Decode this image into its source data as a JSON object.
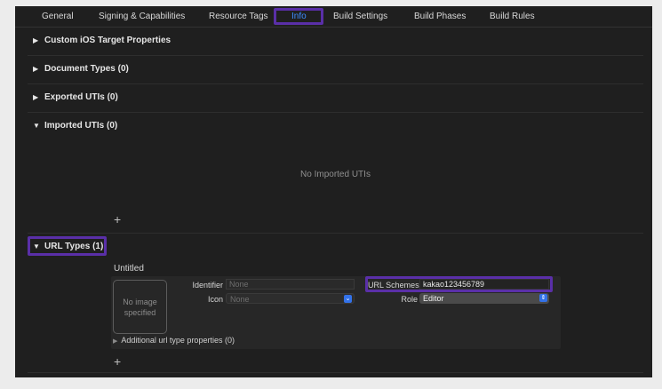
{
  "tabs": [
    {
      "label": "General",
      "selected": false
    },
    {
      "label": "Signing & Capabilities",
      "selected": false
    },
    {
      "label": "Resource Tags",
      "selected": false
    },
    {
      "label": "Info",
      "selected": true
    },
    {
      "label": "Build Settings",
      "selected": false
    },
    {
      "label": "Build Phases",
      "selected": false
    },
    {
      "label": "Build Rules",
      "selected": false
    }
  ],
  "sections": {
    "custom": {
      "title": "Custom iOS Target Properties",
      "expanded": false
    },
    "document": {
      "title": "Document Types (0)",
      "expanded": false
    },
    "exported": {
      "title": "Exported UTIs (0)",
      "expanded": false
    },
    "imported": {
      "title": "Imported UTIs (0)",
      "expanded": true,
      "empty_text": "No Imported UTIs",
      "add": "+"
    },
    "url": {
      "title": "URL Types (1)",
      "expanded": true,
      "add": "+"
    }
  },
  "url_type": {
    "name": "Untitled",
    "image_placeholder": "No image specified",
    "identifier_label": "Identifier",
    "identifier_placeholder": "None",
    "icon_label": "Icon",
    "icon_placeholder": "None",
    "schemes_label": "URL Schemes",
    "schemes_value": "kakao123456789",
    "role_label": "Role",
    "role_value": "Editor",
    "additional": "Additional url type properties (0)"
  },
  "icons": {
    "collapsed": "▶",
    "expanded": "▼",
    "popup_chevron": "chevron-down",
    "stepper": "up-down-chevrons"
  },
  "colors": {
    "background": "#1f1f1f",
    "highlight": "#5a2fa8",
    "accent": "#3d8cff"
  }
}
